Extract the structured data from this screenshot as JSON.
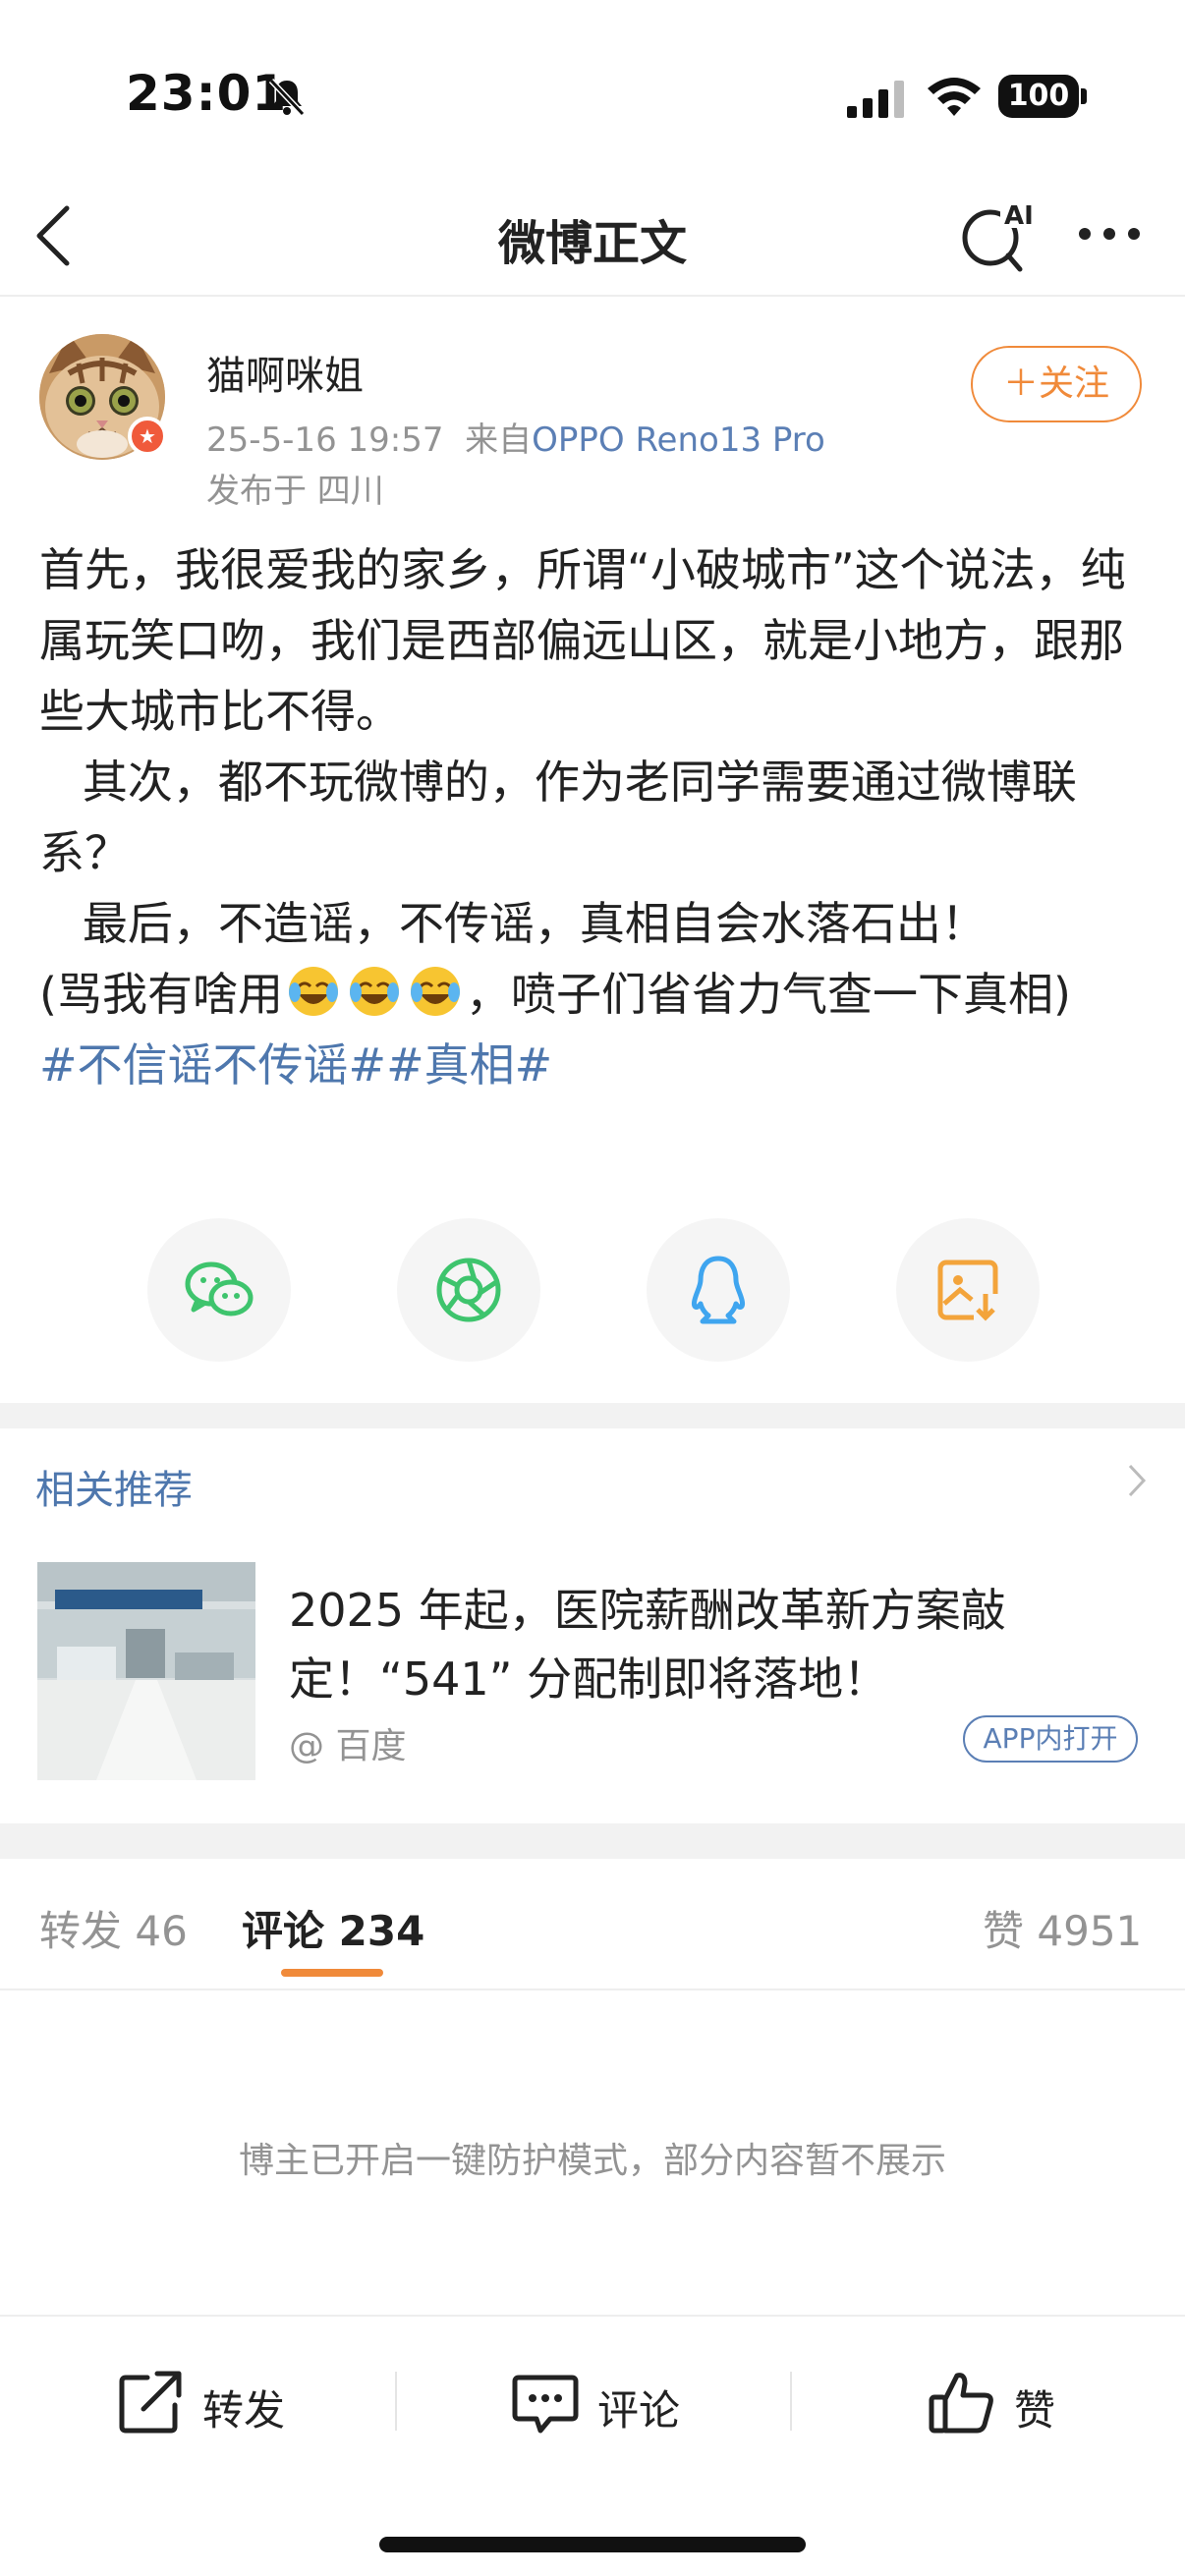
{
  "status_bar": {
    "time": "23:01",
    "battery": "100"
  },
  "nav": {
    "title": "微博正文",
    "ai_label": "AI"
  },
  "post": {
    "author": "猫啊咪姐",
    "date": "25-5-16 19:57",
    "source_prefix": "来自",
    "source": "OPPO Reno13 Pro",
    "location": "发布于 四川",
    "follow_label": "＋关注",
    "para1": "首先，我很爱我的家乡，所谓“小破城市”这个说法，纯属玩笑口吻，我们是西部偏远山区，就是小地方，跟那些大城市比不得。",
    "para2": "   其次，都不玩微博的，作为老同学需要通过微博联系？",
    "para3": "   最后，不造谣，不传谣，真相自会水落石出！",
    "para4_start": "(骂我有啥用",
    "para4_end": "，喷子们省省力气查一下真相)",
    "hashtags": "#不信谣不传谣##真相#"
  },
  "share_icons": [
    "wechat-icon",
    "moments-icon",
    "qq-icon",
    "save-image-icon"
  ],
  "related": {
    "title": "相关推荐",
    "headline": "2025 年起，医院薪酬改革新方案敲定！“541” 分配制即将落地！",
    "source": "@ 百度",
    "app_open": "APP内打开"
  },
  "tabs": {
    "repost_label": "转发",
    "repost_count": "46",
    "comment_label": "评论",
    "comment_count": "234",
    "like_label": "赞",
    "like_count": "4951"
  },
  "protect_note": "博主已开启一键防护模式，部分内容暂不展示",
  "bottom_bar": {
    "repost": "转发",
    "comment": "评论",
    "like": "赞"
  },
  "colors": {
    "accent_orange": "#f08a3a",
    "link_blue": "#4e77ad",
    "meta_gray": "#939393",
    "wechat_green": "#3ec46d",
    "qq_blue": "#3fa5ef",
    "save_orange": "#f3a43b"
  }
}
